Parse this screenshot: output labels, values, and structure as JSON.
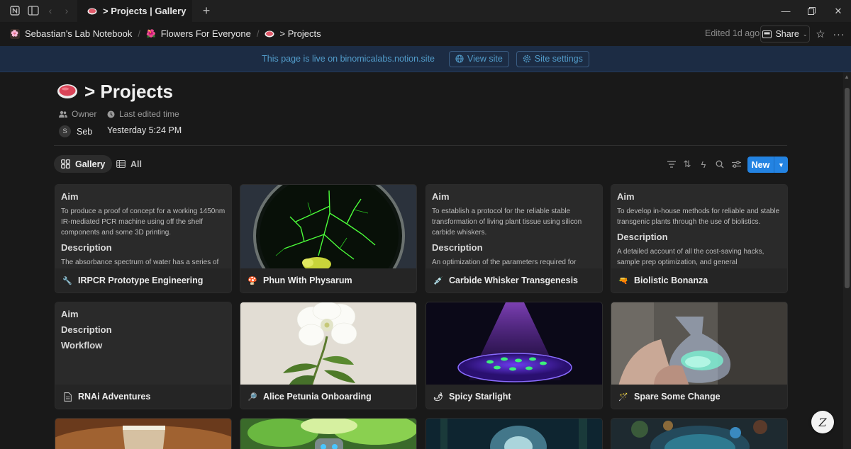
{
  "window": {
    "tab_title": "> Projects | Gallery"
  },
  "breadcrumb": [
    {
      "label": "Sebastian's Lab Notebook"
    },
    {
      "label": "Flowers For Everyone"
    },
    {
      "label": "> Projects"
    }
  ],
  "topbar": {
    "edited": "Edited 1d ago",
    "share_label": "Share"
  },
  "banner": {
    "text": "This page is live on binomicalabs.notion.site",
    "view_site": "View site",
    "site_settings": "Site settings"
  },
  "page": {
    "title": "> Projects",
    "properties": {
      "owner_label": "Owner",
      "owner_value": "Seb",
      "owner_initial": "S",
      "edited_label": "Last edited time",
      "edited_value": "Yesterday 5:24 PM"
    }
  },
  "views": {
    "gallery": "Gallery",
    "all": "All",
    "new_label": "New"
  },
  "cards": [
    {
      "title": "IRPCR Prototype Engineering",
      "icon": "wrench-icon",
      "preview": [
        {
          "h": "Aim"
        },
        {
          "p": "To produce a proof of concept for a working 1450nm IR-mediated PCR machine using off the shelf components and some 3D printing."
        },
        {
          "h": "Description"
        },
        {
          "p": "The absorbance spectrum of water has a series of"
        }
      ]
    },
    {
      "title": "Phun With Physarum",
      "icon": "mushroom-icon",
      "image": "physarum-petri-image"
    },
    {
      "title": "Carbide Whisker Transgenesis",
      "icon": "syringe-icon",
      "preview": [
        {
          "h": "Aim"
        },
        {
          "p": "To establish a protocol for the reliable stable transformation of living plant tissue using silicon carbide whiskers."
        },
        {
          "h": "Description"
        },
        {
          "p": "An optimization of the parameters required for"
        }
      ]
    },
    {
      "title": "Biolistic Bonanza",
      "icon": "gun-icon",
      "preview": [
        {
          "h": "Aim"
        },
        {
          "p": "To develop in-house methods for reliable and stable transgenic plants through the use of biolistics."
        },
        {
          "h": "Description"
        },
        {
          "p": "A detailed account of all the cost-saving hacks, sample prep optimization, and general"
        }
      ]
    },
    {
      "title": "RNAi Adventures",
      "icon": "document-icon",
      "preview": [
        {
          "h": "Aim"
        },
        {
          "h": "Description"
        },
        {
          "h": "Workflow"
        }
      ]
    },
    {
      "title": "Alice Petunia Onboarding",
      "icon": "microscope-icon",
      "image": "white-petunia-image"
    },
    {
      "title": "Spicy Starlight",
      "icon": "chili-pepper-icon",
      "image": "glowing-seedlings-image"
    },
    {
      "title": "Spare Some Change",
      "icon": "magic-wand-icon",
      "image": "glowing-flask-image"
    }
  ],
  "colors": {
    "accent": "#2383e2",
    "banner_bg": "#1c2c44",
    "banner_text": "#529cca"
  }
}
